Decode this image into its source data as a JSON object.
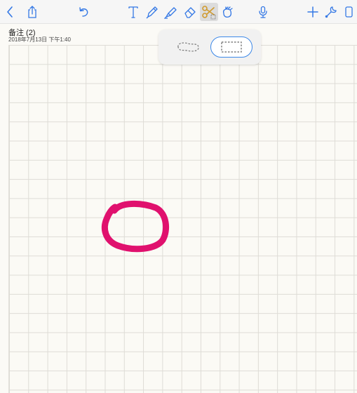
{
  "toolbar": {
    "left_tools": [
      {
        "name": "back",
        "icon": "chevron-left-icon"
      },
      {
        "name": "share",
        "icon": "share-icon"
      },
      {
        "name": "undo",
        "icon": "undo-icon"
      }
    ],
    "drawing_tools": [
      {
        "name": "text",
        "icon": "text-tool-icon"
      },
      {
        "name": "pen",
        "icon": "pen-icon"
      },
      {
        "name": "highlighter",
        "icon": "highlighter-icon"
      },
      {
        "name": "eraser",
        "icon": "eraser-icon"
      },
      {
        "name": "lasso-scissors",
        "icon": "scissors-icon",
        "active": true
      },
      {
        "name": "hand",
        "icon": "hand-icon"
      }
    ],
    "right_tools": [
      {
        "name": "microphone",
        "icon": "microphone-icon"
      },
      {
        "name": "add",
        "icon": "plus-icon"
      },
      {
        "name": "settings",
        "icon": "wrench-icon"
      },
      {
        "name": "pages",
        "icon": "page-icon"
      }
    ],
    "icon_color": "#3478e5",
    "active_tool_color": "#d09a2e"
  },
  "note": {
    "title": "备注 (2)",
    "date": "2018年7月13日 下午1:40"
  },
  "selection_popover": {
    "options": [
      {
        "name": "freeform-lasso",
        "icon": "freeform-selection-icon",
        "selected": false
      },
      {
        "name": "rectangle-select",
        "icon": "rectangle-selection-icon",
        "selected": true
      }
    ],
    "accent": "#3c88e8"
  },
  "canvas": {
    "paper": "grid",
    "ink_color": "#e0116e",
    "stroke": "hand-drawn-circle"
  }
}
